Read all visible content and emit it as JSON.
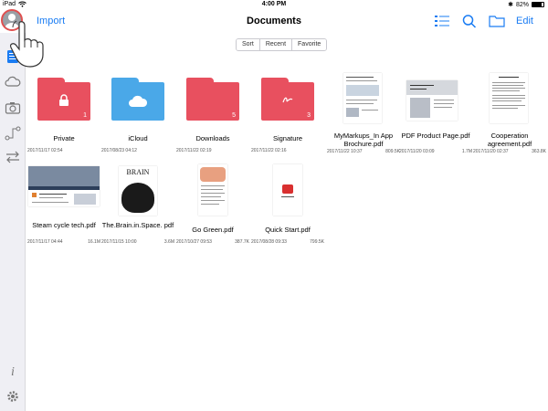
{
  "status": {
    "device": "iPad",
    "time": "4:00 PM",
    "battery": "82%",
    "battery_level": 0.82
  },
  "nav": {
    "import_label": "Import",
    "title": "Documents",
    "edit_label": "Edit"
  },
  "segments": [
    "Sort",
    "Recent",
    "Favorite"
  ],
  "items": [
    {
      "name": "Private",
      "date": "2017/11/17 02:54",
      "size": "",
      "count": "1"
    },
    {
      "name": "iCloud",
      "date": "2017/08/23 04:12",
      "size": "",
      "count": ""
    },
    {
      "name": "Downloads",
      "date": "2017/11/22 02:19",
      "size": "",
      "count": "5"
    },
    {
      "name": "Signature",
      "date": "2017/11/22 02:16",
      "size": "",
      "count": "3"
    },
    {
      "name": "MyMarkups_In App Brochure.pdf",
      "date": "2017/11/22 10:37",
      "size": "809.5K"
    },
    {
      "name": "PDF Product Page.pdf",
      "date": "2017/11/20 03:09",
      "size": "1.7M"
    },
    {
      "name": "Cooperation agreement.pdf",
      "date": "2017/11/20 02:37",
      "size": "363.8K"
    },
    {
      "name": "Steam cycle tech.pdf",
      "date": "2017/11/17 04:44",
      "size": "16.1M"
    },
    {
      "name": "The.Brain.in.Space. pdf",
      "date": "2017/11/15 10:00",
      "size": "3.6M"
    },
    {
      "name": "Go Green.pdf",
      "date": "2017/10/27 09:53",
      "size": "387.7K"
    },
    {
      "name": "Quick Start.pdf",
      "date": "2017/08/28 09:33",
      "size": "799.5K"
    }
  ],
  "colors": {
    "accent": "#1a7cf3",
    "folder_red": "#e8505f",
    "folder_blue": "#4aa8e8"
  }
}
